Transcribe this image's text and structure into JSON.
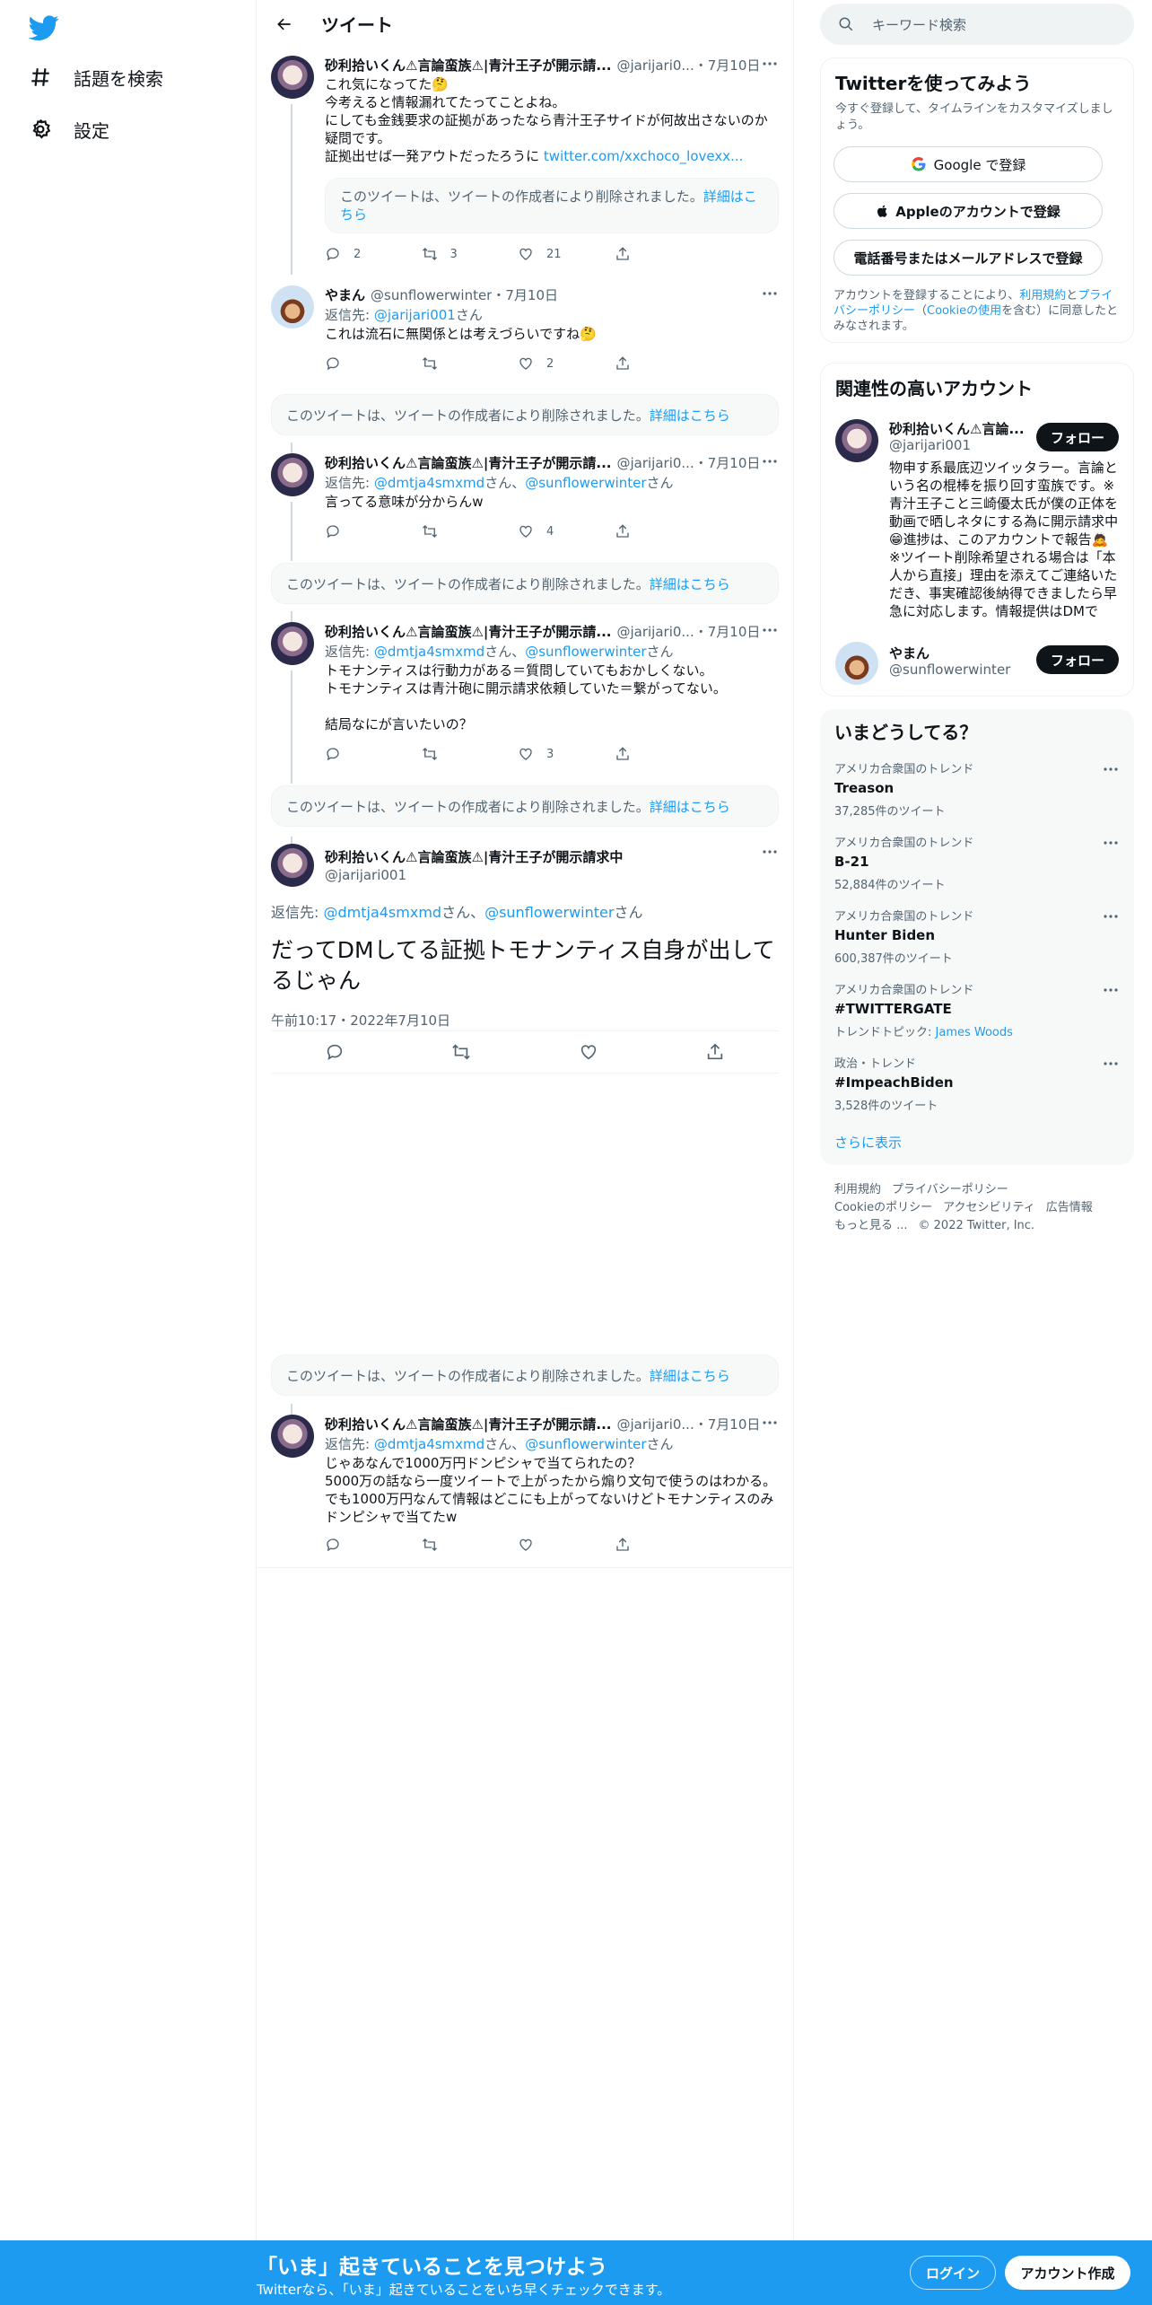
{
  "nav": {
    "explore": "話題を検索",
    "settings": "設定"
  },
  "header": {
    "title": "ツイート"
  },
  "tweets": [
    {
      "name": "砂利拾いくん⚠言論蛮族⚠|青汁王子が開示請...",
      "handle": "@jarijari0...",
      "date": "・7月10日",
      "text": "これ気になってた🤔\n今考えると情報漏れてたってことよね。\nにしても金銭要求の証拠があったなら青汁王子サイドが何故出さないのか疑問です。\n証拠出せば一発アウトだったろうに ",
      "link": "twitter.com/xxchoco_lovexx...",
      "quote_text": "このツイートは、ツイートの作成者により削除されました。",
      "quote_link": "詳細はこちら",
      "replies": "2",
      "retweets": "3",
      "likes": "21"
    },
    {
      "name": "やまん",
      "handle": "@sunflowerwinter",
      "date": "・7月10日",
      "reply_prefix": "返信先: ",
      "reply_to": "@jarijari001",
      "reply_suffix": "さん",
      "text": "これは流石に無関係とは考えづらいですね🤔",
      "replies": "",
      "retweets": "",
      "likes": "2"
    },
    {
      "name": "砂利拾いくん⚠言論蛮族⚠|青汁王子が開示請...",
      "handle": "@jarijari0...",
      "date": "・7月10日",
      "reply_prefix": "返信先: ",
      "reply_to": "@dmtja4smxmd",
      "reply_mid": "さん、",
      "reply_to2": "@sunflowerwinter",
      "reply_suffix": "さん",
      "text": "言ってる意味が分からんw",
      "replies": "",
      "retweets": "",
      "likes": "4"
    },
    {
      "name": "砂利拾いくん⚠言論蛮族⚠|青汁王子が開示請...",
      "handle": "@jarijari0...",
      "date": "・7月10日",
      "reply_prefix": "返信先: ",
      "reply_to": "@dmtja4smxmd",
      "reply_mid": "さん、",
      "reply_to2": "@sunflowerwinter",
      "reply_suffix": "さん",
      "text": "トモナンティスは行動力がある＝質問していてもおかしくない。\nトモナンティスは青汁砲に開示請求依頼していた＝繋がってない。\n\n結局なにが言いたいの？",
      "replies": "",
      "retweets": "",
      "likes": "3"
    },
    {
      "name": "砂利拾いくん⚠言論蛮族⚠|青汁王子が開示請...",
      "handle": "@jarijari0...",
      "date": "・7月10日",
      "reply_prefix": "返信先: ",
      "reply_to": "@dmtja4smxmd",
      "reply_mid": "さん、",
      "reply_to2": "@sunflowerwinter",
      "reply_suffix": "さん",
      "text": "じゃあなんで1000万円ドンピシャで当てられたの？\n5000万の話なら一度ツイートで上がったから煽り文句で使うのはわかる。\nでも1000万円なんて情報はどこにも上がってないけどトモナンティスのみドンピシャで当てたw",
      "replies": "",
      "retweets": "",
      "likes": ""
    }
  ],
  "deleted": {
    "text": "このツイートは、ツイートの作成者により削除されました。",
    "link": "詳細はこちら"
  },
  "focus": {
    "name": "砂利拾いくん⚠言論蛮族⚠|青汁王子が開示請求中",
    "handle": "@jarijari001",
    "reply_prefix": "返信先: ",
    "reply_to": "@dmtja4smxmd",
    "reply_mid": "さん、",
    "reply_to2": "@sunflowerwinter",
    "reply_suffix": "さん",
    "text": "だってDMしてる証拠トモナンティス自身が出してるじゃん",
    "time": "午前10:17・2022年7月10日"
  },
  "search": {
    "placeholder": "キーワード検索"
  },
  "signup_card": {
    "title": "Twitterを使ってみよう",
    "subtitle": "今すぐ登録して、タイムラインをカスタマイズしましょう。",
    "google": "Google で登録",
    "apple": "Appleのアカウントで登録",
    "phone": "電話番号またはメールアドレスで登録",
    "terms_pre": "アカウントを登録することにより、",
    "terms_link": "利用規約",
    "terms_and": "と",
    "privacy_link": "プライバシーポリシー",
    "terms_mid": "（",
    "cookie_link": "Cookieの使用",
    "terms_post": "を含む）に同意したとみなされます。"
  },
  "related": {
    "title": "関連性の高いアカウント",
    "accounts": [
      {
        "name": "砂利拾いくん⚠言論...",
        "handle": "@jarijari001",
        "bio": "物申す系最底辺ツイッタラー。言論という名の棍棒を振り回す蛮族です。※青汁王子こと三崎優太氏が僕の正体を動画で晒しネタにする為に開示請求中😁進捗は、このアカウントで報告🙇※ツイート削除希望される場合は「本人から直接」理由を添えてご連絡いただき、事実確認後納得できましたら早急に対応します。情報提供はDMで",
        "follow": "フォロー"
      },
      {
        "name": "やまん",
        "handle": "@sunflowerwinter",
        "follow": "フォロー"
      }
    ]
  },
  "trends": {
    "title": "いまどうしてる？",
    "items": [
      {
        "ctx": "アメリカ合衆国のトレンド",
        "name": "Treason",
        "count": "37,285件のツイート"
      },
      {
        "ctx": "アメリカ合衆国のトレンド",
        "name": "B-21",
        "count": "52,884件のツイート"
      },
      {
        "ctx": "アメリカ合衆国のトレンド",
        "name": "Hunter Biden",
        "count": "600,387件のツイート"
      },
      {
        "ctx": "アメリカ合衆国のトレンド",
        "name": "#TWITTERGATE",
        "count_prefix": "トレンドトピック: ",
        "count_link": "James Woods"
      },
      {
        "ctx": "政治・トレンド",
        "name": "#ImpeachBiden",
        "count": "3,528件のツイート"
      }
    ],
    "show_more": "さらに表示"
  },
  "footer": {
    "links": [
      "利用規約",
      "プライバシーポリシー",
      "Cookieのポリシー",
      "アクセシビリティ",
      "広告情報",
      "もっと見る ..."
    ],
    "copyright": "© 2022 Twitter, Inc."
  },
  "banner": {
    "title": "「いま」起きていることを見つけよう",
    "subtitle": "Twitterなら、「いま」起きていることをいち早くチェックできます。",
    "login": "ログイン",
    "signup": "アカウント作成"
  },
  "colors": {
    "accent": "#1d9bf0",
    "text": "#0f1419",
    "muted": "#536471",
    "line": "#cfd9de"
  }
}
